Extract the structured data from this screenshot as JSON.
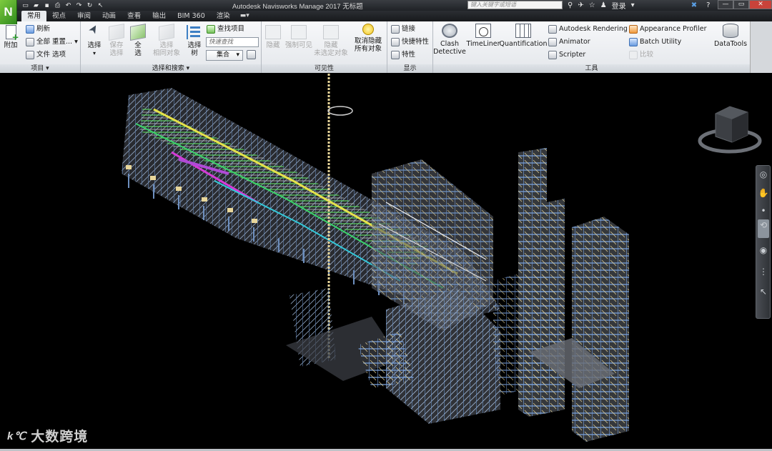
{
  "titlebar": {
    "window_title": "Autodesk Navisworks Manage 2017    无标题",
    "help_search_placeholder": "键入关键字或短语",
    "login_label": "登录",
    "help_label": "?"
  },
  "logo": {
    "letter": "N"
  },
  "tabs": [
    {
      "label": "常用",
      "active": true
    },
    {
      "label": "视点",
      "active": false
    },
    {
      "label": "审阅",
      "active": false
    },
    {
      "label": "动画",
      "active": false
    },
    {
      "label": "查看",
      "active": false
    },
    {
      "label": "输出",
      "active": false
    },
    {
      "label": "BIM 360",
      "active": false
    },
    {
      "label": "渲染",
      "active": false
    }
  ],
  "ribbon": {
    "project": {
      "label": "项目 ▾",
      "append": "附加",
      "refresh": "刷新",
      "reset_all": "全部 重置...",
      "file_options": "文件 选项"
    },
    "select_search": {
      "label": "选择和搜索 ▾",
      "select": "选择",
      "save_selection_1": "保存",
      "save_selection_2": "选择",
      "select_all_1": "全",
      "select_all_2": "选",
      "select_same_1": "选择",
      "select_same_2": "相同对象",
      "selection_tree_1": "选择",
      "selection_tree_2": "树",
      "find_items": "查找项目",
      "quick_find_placeholder": "快速查找",
      "sets_combo": "集合"
    },
    "visibility": {
      "label": "可见性",
      "hide": "隐藏",
      "require": "强制可见",
      "hide_unselected_1": "隐藏",
      "hide_unselected_2": "未选定对象",
      "unhide_all_1": "取消隐藏",
      "unhide_all_2": "所有对象"
    },
    "display": {
      "label": "显示",
      "links": "链接",
      "quick_properties": "快捷特性",
      "properties": "特性"
    },
    "tools": {
      "label": "工具",
      "clash_1": "Clash",
      "clash_2": "Detective",
      "timeliner": "TimeLiner",
      "quantification": "Quantification",
      "rendering": "Autodesk Rendering",
      "animator": "Animator",
      "scripter": "Scripter",
      "appearance_profiler": "Appearance Profiler",
      "batch_utility": "Batch Utility",
      "compare": "比较",
      "datatools": "DataTools"
    }
  },
  "watermark": {
    "mark": "k℃",
    "text": "大数跨境"
  }
}
